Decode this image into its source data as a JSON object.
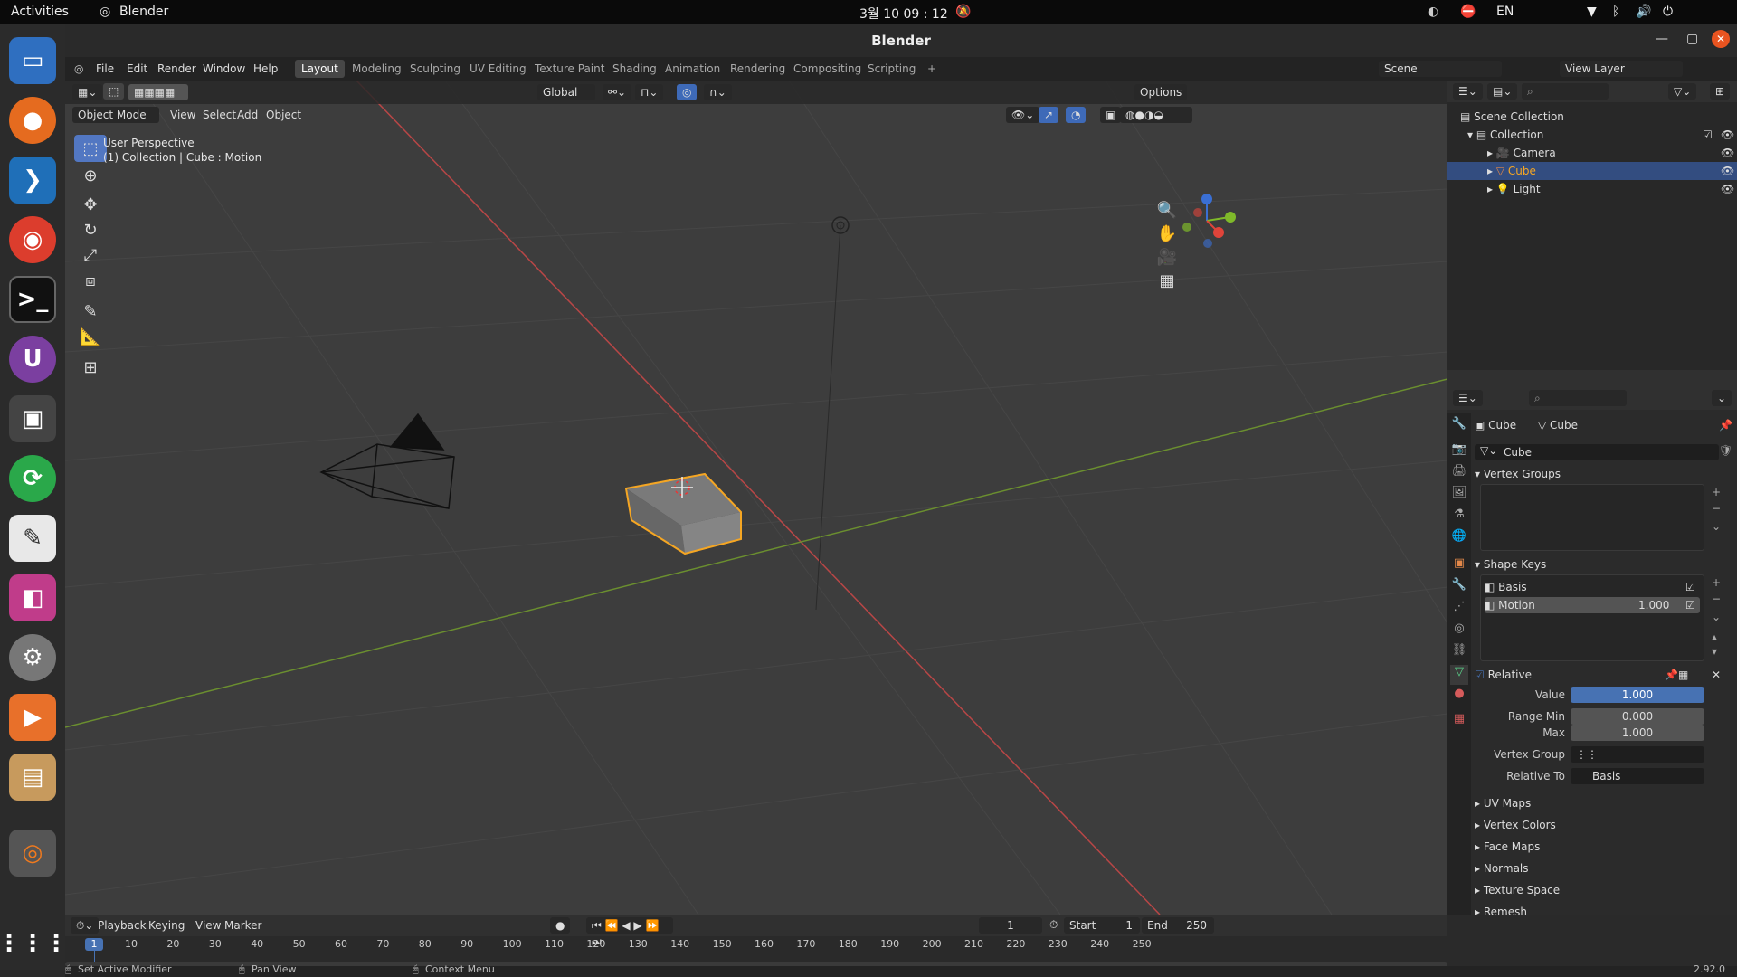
{
  "system": {
    "activities": "Activities",
    "app": "Blender",
    "clock": "3월 10  09 : 12",
    "lang": "EN"
  },
  "window": {
    "title": "Blender",
    "version": "2.92.0"
  },
  "menu": {
    "file": "File",
    "edit": "Edit",
    "render": "Render",
    "window": "Window",
    "help": "Help"
  },
  "workspaces": [
    "Layout",
    "Modeling",
    "Sculpting",
    "UV Editing",
    "Texture Paint",
    "Shading",
    "Animation",
    "Rendering",
    "Compositing",
    "Scripting"
  ],
  "scene": {
    "scene_name": "Scene",
    "view_layer": "View Layer"
  },
  "viewport": {
    "mode": "Object Mode",
    "view": "View",
    "select": "Select",
    "add": "Add",
    "object": "Object",
    "orientation": "Global",
    "options": "Options",
    "overlay_line1": "User Perspective",
    "overlay_line2": "(1) Collection | Cube : Motion"
  },
  "outliner": {
    "scene_collection": "Scene Collection",
    "collection": "Collection",
    "items": [
      "Camera",
      "Cube",
      "Light"
    ]
  },
  "properties": {
    "object_name": "Cube",
    "mesh_name": "Cube",
    "data_field": "Cube",
    "vertex_groups": "Vertex Groups",
    "shape_keys": "Shape Keys",
    "keys": [
      {
        "name": "Basis",
        "value": ""
      },
      {
        "name": "Motion",
        "value": "1.000"
      }
    ],
    "relative": "Relative",
    "value_label": "Value",
    "value": "1.000",
    "range_min_label": "Range Min",
    "range_min": "0.000",
    "max_label": "Max",
    "max": "1.000",
    "vertex_group_label": "Vertex Group",
    "relative_to_label": "Relative To",
    "relative_to": "Basis",
    "collapsed": [
      "UV Maps",
      "Vertex Colors",
      "Face Maps",
      "Normals",
      "Texture Space",
      "Remesh"
    ]
  },
  "timeline": {
    "playback": "Playback",
    "keying": "Keying",
    "view": "View",
    "marker": "Marker",
    "current": "1",
    "start_label": "Start",
    "start": "1",
    "end_label": "End",
    "end": "250",
    "ticks": [
      "10",
      "20",
      "30",
      "40",
      "50",
      "60",
      "70",
      "80",
      "90",
      "100",
      "110",
      "120",
      "130",
      "140",
      "150",
      "160",
      "170",
      "180",
      "190",
      "200",
      "210",
      "220",
      "230",
      "240",
      "250"
    ]
  },
  "status": {
    "left": "Set Active Modifier",
    "mid": "Pan View",
    "right": "Context Menu"
  }
}
